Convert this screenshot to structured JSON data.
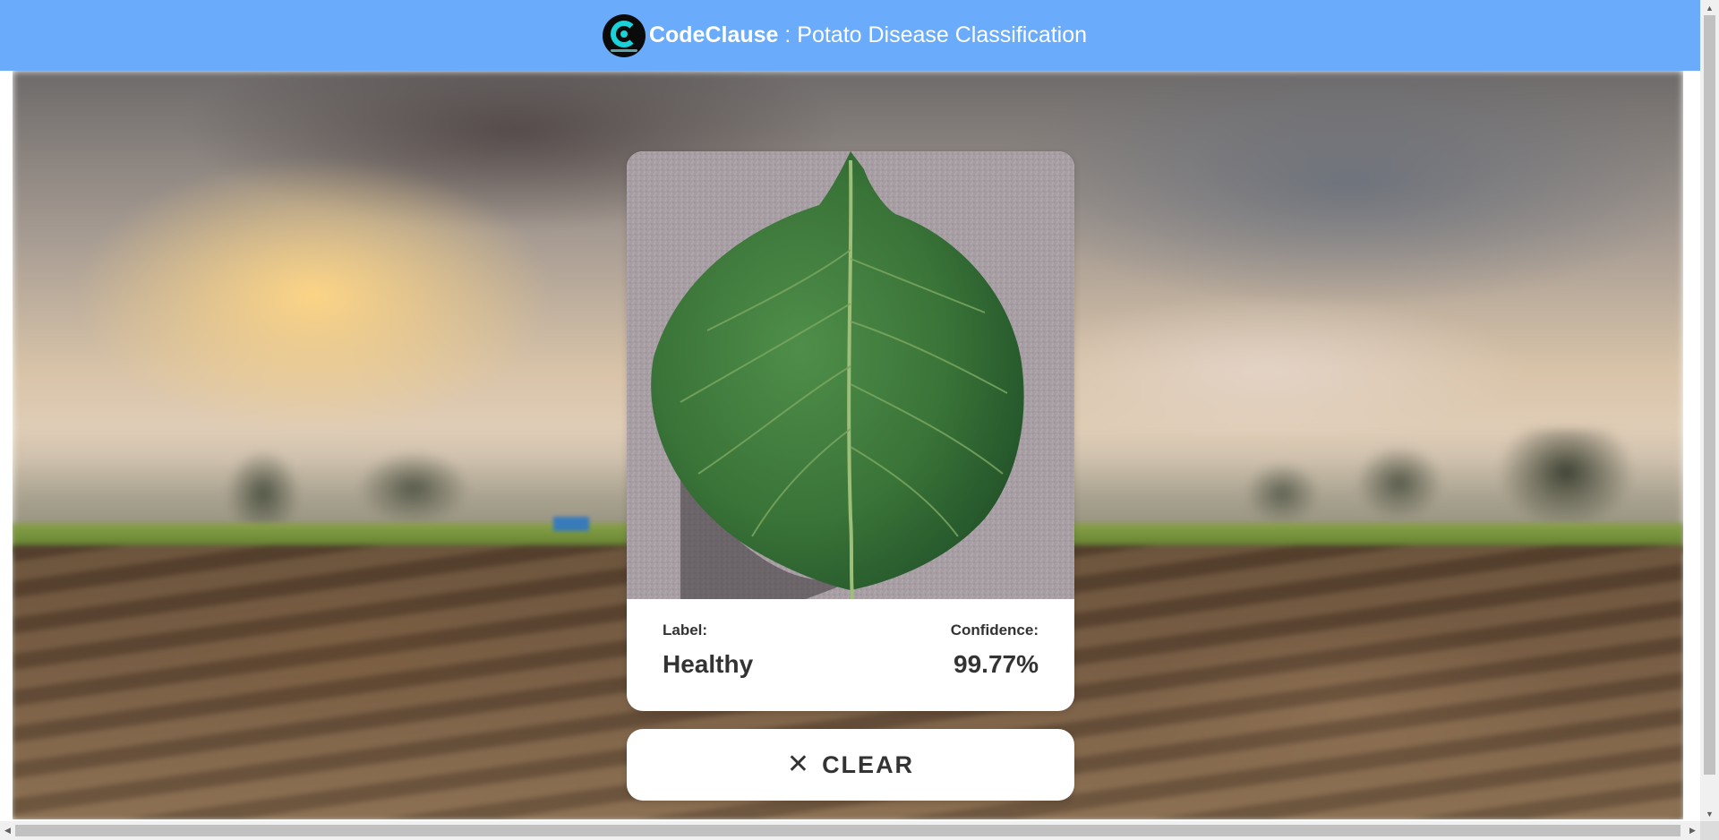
{
  "header": {
    "brand_name": "CodeClause",
    "separator": " : ",
    "app_title": "Potato Disease Classification",
    "background_color": "#6aabfb",
    "logo_icon": "codeclause-logo-icon"
  },
  "result": {
    "image_icon": "potato-leaf-image",
    "label_caption": "Label:",
    "label_value": "Healthy",
    "confidence_caption": "Confidence:",
    "confidence_value": "99.77%"
  },
  "actions": {
    "clear_icon": "close-icon",
    "clear_glyph": "✕",
    "clear_label": "CLEAR"
  },
  "scrollbars": {
    "up_arrow": "▲",
    "down_arrow": "▼",
    "left_arrow": "◀",
    "right_arrow": "▶"
  }
}
